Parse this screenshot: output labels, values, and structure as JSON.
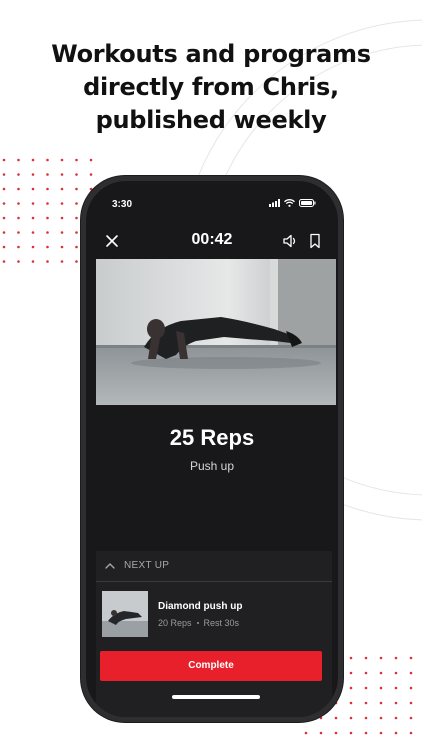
{
  "headline": {
    "line1": "Workouts and programs",
    "line2": "directly from Chris,",
    "line3": "published weekly"
  },
  "status_bar": {
    "time": "3:30"
  },
  "workout": {
    "timer": "00:42",
    "reps": "25 Reps",
    "exercise": "Push up"
  },
  "next_up": {
    "label": "NEXT UP",
    "name": "Diamond push up",
    "reps": "20 Reps",
    "rest": "Rest 30s"
  },
  "actions": {
    "complete_label": "Complete"
  },
  "icons": [
    "close-icon",
    "speaker-icon",
    "bookmark-icon",
    "chevron-up-icon",
    "signal-icon",
    "wifi-icon",
    "battery-icon"
  ],
  "colors": {
    "accent": "#e8202b",
    "screen_bg": "#18181a",
    "panel_bg": "#202023",
    "dots": "#d8323c"
  }
}
